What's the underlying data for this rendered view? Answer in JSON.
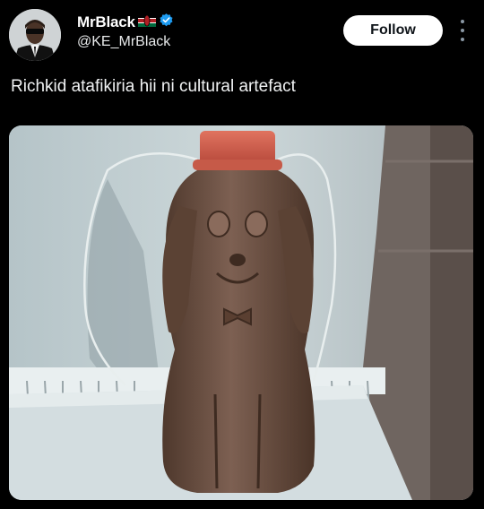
{
  "author": {
    "display_name": "MrBlack",
    "flag_icon": "kenya-flag-icon",
    "verified_icon": "verified-badge-icon",
    "handle": "@KE_MrBlack"
  },
  "actions": {
    "follow_label": "Follow",
    "more_icon": "more-vertical-icon"
  },
  "tweet": {
    "text": "Richkid atafikiria hii ni cultural artefact"
  },
  "media": {
    "icon": "photo-icon"
  },
  "colors": {
    "background": "#000000",
    "verified": "#1d9bf0",
    "follow_bg": "#ffffff"
  }
}
